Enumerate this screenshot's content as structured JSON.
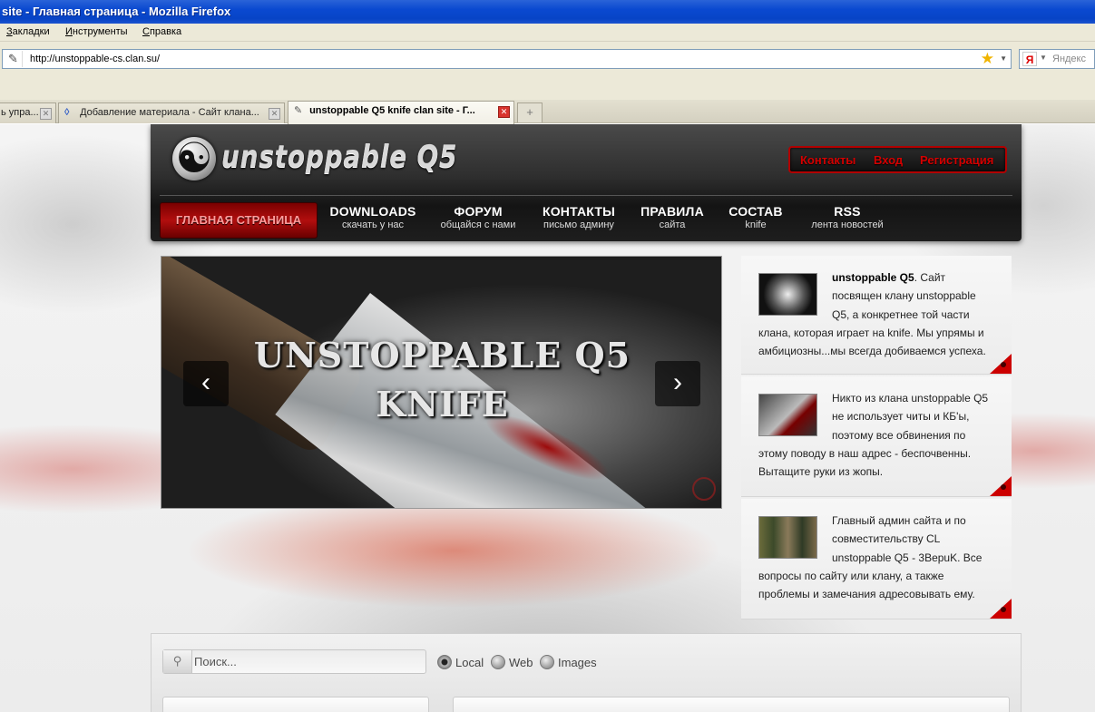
{
  "window": {
    "title": "site - Главная страница - Mozilla Firefox"
  },
  "menu": [
    {
      "label": "Закладки"
    },
    {
      "label": "Инструменты"
    },
    {
      "label": "Справка"
    }
  ],
  "urlbar": {
    "url": "http://unstoppable-cs.clan.su/"
  },
  "browser_search": {
    "placeholder": "Яндекс",
    "engine_icon": "Я"
  },
  "tabs": [
    {
      "label": "ь упра...",
      "active": false
    },
    {
      "label": "Добавление материала - Сайт клана...",
      "active": false
    },
    {
      "label": "unstoppable Q5 knife clan site - Г...",
      "active": true
    }
  ],
  "site": {
    "logo_text": "unstoppable Q5",
    "top_links": [
      "Контакты",
      "Вход",
      "Регистрация"
    ],
    "nav": {
      "home": "ГЛАВНАЯ СТРАНИЦА",
      "items": [
        {
          "title": "DOWNLOADS",
          "sub": "скачать у нас"
        },
        {
          "title": "ФОРУМ",
          "sub": "общайся с нами"
        },
        {
          "title": "КОНТАКТЫ",
          "sub": "письмо админу"
        },
        {
          "title": "ПРАВИЛА",
          "sub": "сайта"
        },
        {
          "title": "СОСТАВ",
          "sub": "knife"
        },
        {
          "title": "RSS",
          "sub": "лента новостей"
        }
      ]
    },
    "slider": {
      "line1": "UNSTOPPABLE Q5",
      "line2": "KNIFE",
      "prev": "‹",
      "next": "›"
    },
    "side_boxes": [
      {
        "bold": "unstoppable Q5",
        "text": ". Сайт посвящен клану unstoppable Q5, а конкретнее той части клана, которая играет на knife. Мы упрямы и амбициозны...мы всегда добиваемся успеха."
      },
      {
        "bold": "",
        "text": "Никто из клана unstoppable Q5 не использует читы и КБ'ы, поэтому все обвинения по этому поводу в наш адрес - беспочвенны. Вытащите руки из жопы."
      },
      {
        "bold": "",
        "text": "Главный админ сайта и по совместительству CL unstoppable Q5 - 3BepuK. Все вопросы по сайту или клану, а также проблемы и замечания адресовывать ему."
      }
    ],
    "search": {
      "placeholder": "Поиск...",
      "options": [
        {
          "label": "Local",
          "selected": true
        },
        {
          "label": "Web",
          "selected": false
        },
        {
          "label": "Images",
          "selected": false
        }
      ]
    }
  }
}
